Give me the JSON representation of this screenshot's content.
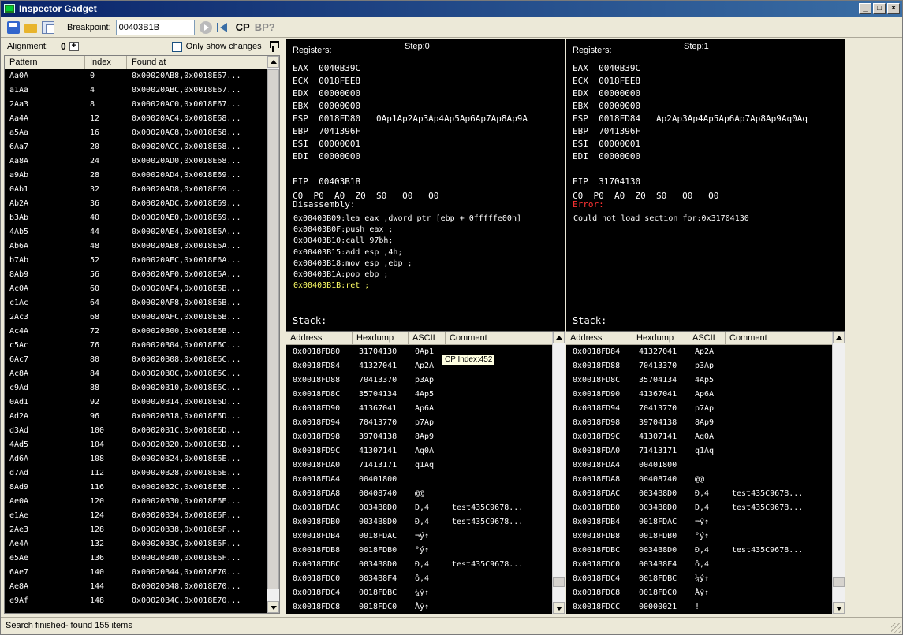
{
  "window": {
    "title": "Inspector Gadget"
  },
  "toolbar": {
    "breakpoint_label": "Breakpoint:",
    "breakpoint_value": "00403B1B",
    "cp_label": "CP",
    "bp_label": "BP?"
  },
  "left": {
    "alignment_label": "Alignment:",
    "alignment_value": "0",
    "only_changes_label": "Only show changes",
    "columns": [
      "Pattern",
      "Index",
      "Found at"
    ],
    "rows": [
      [
        "Aa0A",
        "0",
        "0x00020AB8,0x0018E67..."
      ],
      [
        "a1Aa",
        "4",
        "0x00020ABC,0x0018E67..."
      ],
      [
        "2Aa3",
        "8",
        "0x00020AC0,0x0018E67..."
      ],
      [
        "Aa4A",
        "12",
        "0x00020AC4,0x0018E68..."
      ],
      [
        "a5Aa",
        "16",
        "0x00020AC8,0x0018E68..."
      ],
      [
        "6Aa7",
        "20",
        "0x00020ACC,0x0018E68..."
      ],
      [
        "Aa8A",
        "24",
        "0x00020AD0,0x0018E68..."
      ],
      [
        "a9Ab",
        "28",
        "0x00020AD4,0x0018E69..."
      ],
      [
        "0Ab1",
        "32",
        "0x00020AD8,0x0018E69..."
      ],
      [
        "Ab2A",
        "36",
        "0x00020ADC,0x0018E69..."
      ],
      [
        "b3Ab",
        "40",
        "0x00020AE0,0x0018E69..."
      ],
      [
        "4Ab5",
        "44",
        "0x00020AE4,0x0018E6A..."
      ],
      [
        "Ab6A",
        "48",
        "0x00020AE8,0x0018E6A..."
      ],
      [
        "b7Ab",
        "52",
        "0x00020AEC,0x0018E6A..."
      ],
      [
        "8Ab9",
        "56",
        "0x00020AF0,0x0018E6A..."
      ],
      [
        "Ac0A",
        "60",
        "0x00020AF4,0x0018E6B..."
      ],
      [
        "c1Ac",
        "64",
        "0x00020AF8,0x0018E6B..."
      ],
      [
        "2Ac3",
        "68",
        "0x00020AFC,0x0018E6B..."
      ],
      [
        "Ac4A",
        "72",
        "0x00020B00,0x0018E6B..."
      ],
      [
        "c5Ac",
        "76",
        "0x00020B04,0x0018E6C..."
      ],
      [
        "6Ac7",
        "80",
        "0x00020B08,0x0018E6C..."
      ],
      [
        "Ac8A",
        "84",
        "0x00020B0C,0x0018E6C..."
      ],
      [
        "c9Ad",
        "88",
        "0x00020B10,0x0018E6C..."
      ],
      [
        "0Ad1",
        "92",
        "0x00020B14,0x0018E6D..."
      ],
      [
        "Ad2A",
        "96",
        "0x00020B18,0x0018E6D..."
      ],
      [
        "d3Ad",
        "100",
        "0x00020B1C,0x0018E6D..."
      ],
      [
        "4Ad5",
        "104",
        "0x00020B20,0x0018E6D..."
      ],
      [
        "Ad6A",
        "108",
        "0x00020B24,0x0018E6E..."
      ],
      [
        "d7Ad",
        "112",
        "0x00020B28,0x0018E6E..."
      ],
      [
        "8Ad9",
        "116",
        "0x00020B2C,0x0018E6E..."
      ],
      [
        "Ae0A",
        "120",
        "0x00020B30,0x0018E6E..."
      ],
      [
        "e1Ae",
        "124",
        "0x00020B34,0x0018E6F..."
      ],
      [
        "2Ae3",
        "128",
        "0x00020B38,0x0018E6F..."
      ],
      [
        "Ae4A",
        "132",
        "0x00020B3C,0x0018E6F..."
      ],
      [
        "e5Ae",
        "136",
        "0x00020B40,0x0018E6F..."
      ],
      [
        "6Ae7",
        "140",
        "0x00020B44,0x0018E70..."
      ],
      [
        "Ae8A",
        "144",
        "0x00020B48,0x0018E70..."
      ],
      [
        "e9Af",
        "148",
        "0x00020B4C,0x0018E70..."
      ]
    ]
  },
  "steps": [
    {
      "registers_label": "Registers:",
      "step_label": "Step:0",
      "regs": [
        "EAX  0040B39C",
        "ECX  0018FEE8",
        "EDX  00000000",
        "EBX  00000000",
        "ESP  0018FD80   0Ap1Ap2Ap3Ap4Ap5Ap6Ap7Ap8Ap9A",
        "EBP  7041396F",
        "ESI  00000001",
        "EDI  00000000",
        "",
        "EIP  00403B1B",
        "C0  P0  A0  Z0  S0   O0   O0"
      ],
      "disasm_label": "Disassembly:",
      "disasm": [
        "0x00403B09:lea eax ,dword ptr [ebp + 0fffffe00h]",
        "0x00403B0F:push eax ;",
        "0x00403B10:call 97bh;",
        "0x00403B15:add esp ,4h;",
        "0x00403B18:mov esp ,ebp ;",
        "0x00403B1A:pop ebp ;"
      ],
      "disasm_current": "0x00403B1B:ret ;",
      "stack_label": "Stack:",
      "stack_columns": [
        "Address",
        "Hexdump",
        "ASCII",
        "Comment"
      ],
      "stack_first": [
        "0x0018FD80",
        "31704130",
        "0Ap1",
        ""
      ],
      "stack": [
        [
          "0x0018FD84",
          "41327041",
          "Ap2A",
          ""
        ],
        [
          "0x0018FD88",
          "70413370",
          "p3Ap",
          ""
        ],
        [
          "0x0018FD8C",
          "35704134",
          "4Ap5",
          ""
        ],
        [
          "0x0018FD90",
          "41367041",
          "Ap6A",
          ""
        ],
        [
          "0x0018FD94",
          "70413770",
          "p7Ap",
          ""
        ],
        [
          "0x0018FD98",
          "39704138",
          "8Ap9",
          ""
        ],
        [
          "0x0018FD9C",
          "41307141",
          "Aq0A",
          ""
        ],
        [
          "0x0018FDA0",
          "71413171",
          "q1Aq",
          ""
        ],
        [
          "0x0018FDA4",
          "00401800",
          "",
          ""
        ],
        [
          "0x0018FDA8",
          "00408740",
          "@@",
          ""
        ],
        [
          "0x0018FDAC",
          "0034B8D0",
          "Ð,4",
          "test435C9678..."
        ],
        [
          "0x0018FDB0",
          "0034B8D0",
          "Ð,4",
          "test435C9678..."
        ],
        [
          "0x0018FDB4",
          "0018FDAC",
          "¬ý↑",
          ""
        ],
        [
          "0x0018FDB8",
          "0018FDB0",
          "°ý↑",
          ""
        ],
        [
          "0x0018FDBC",
          "0034B8D0",
          "Ð,4",
          "test435C9678..."
        ],
        [
          "0x0018FDC0",
          "0034B8F4",
          "ô,4",
          ""
        ],
        [
          "0x0018FDC4",
          "0018FDBC",
          "¼ý↑",
          ""
        ],
        [
          "0x0018FDC8",
          "0018FDC0",
          "Àý↑",
          ""
        ]
      ],
      "tooltip": "CP Index:452"
    },
    {
      "registers_label": "Registers:",
      "step_label": "Step:1",
      "regs": [
        "EAX  0040B39C",
        "ECX  0018FEE8",
        "EDX  00000000",
        "EBX  00000000",
        "ESP  0018FD84   Ap2Ap3Ap4Ap5Ap6Ap7Ap8Ap9Aq0Aq",
        "EBP  7041396F",
        "ESI  00000001",
        "EDI  00000000",
        "",
        "EIP  31704130",
        "C0  P0  A0  Z0  S0   O0   O0"
      ],
      "error_label": "Error:",
      "error_text": "Could not load section for:0x31704130",
      "stack_label": "Stack:",
      "stack_columns": [
        "Address",
        "Hexdump",
        "ASCII",
        "Comment"
      ],
      "stack_first": [
        "0x0018FD84",
        "41327041",
        "Ap2A",
        ""
      ],
      "stack": [
        [
          "0x0018FD88",
          "70413370",
          "p3Ap",
          ""
        ],
        [
          "0x0018FD8C",
          "35704134",
          "4Ap5",
          ""
        ],
        [
          "0x0018FD90",
          "41367041",
          "Ap6A",
          ""
        ],
        [
          "0x0018FD94",
          "70413770",
          "p7Ap",
          ""
        ],
        [
          "0x0018FD98",
          "39704138",
          "8Ap9",
          ""
        ],
        [
          "0x0018FD9C",
          "41307141",
          "Aq0A",
          ""
        ],
        [
          "0x0018FDA0",
          "71413171",
          "q1Aq",
          ""
        ],
        [
          "0x0018FDA4",
          "00401800",
          "",
          ""
        ],
        [
          "0x0018FDA8",
          "00408740",
          "@@",
          ""
        ],
        [
          "0x0018FDAC",
          "0034B8D0",
          "Ð,4",
          "test435C9678..."
        ],
        [
          "0x0018FDB0",
          "0034B8D0",
          "Ð,4",
          "test435C9678..."
        ],
        [
          "0x0018FDB4",
          "0018FDAC",
          "¬ý↑",
          ""
        ],
        [
          "0x0018FDB8",
          "0018FDB0",
          "°ý↑",
          ""
        ],
        [
          "0x0018FDBC",
          "0034B8D0",
          "Ð,4",
          "test435C9678..."
        ],
        [
          "0x0018FDC0",
          "0034B8F4",
          "ô,4",
          ""
        ],
        [
          "0x0018FDC4",
          "0018FDBC",
          "¼ý↑",
          ""
        ],
        [
          "0x0018FDC8",
          "0018FDC0",
          "Àý↑",
          ""
        ],
        [
          "0x0018FDCC",
          "00000021",
          "!",
          ""
        ]
      ]
    }
  ],
  "status": {
    "text": "Search finished- found 155 items"
  },
  "colors": {
    "highlight_red": "#ff3333",
    "current_yellow": "#ffff66",
    "title_blue": "#0a246a"
  }
}
